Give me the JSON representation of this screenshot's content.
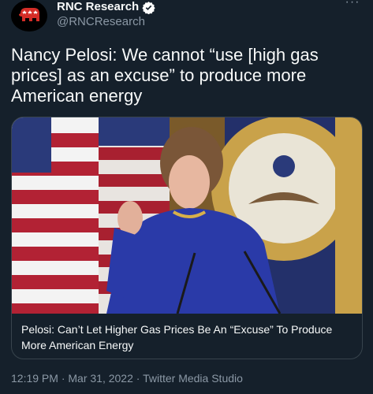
{
  "author": {
    "display_name": "RNC Research",
    "handle": "@RNCResearch"
  },
  "tweet": {
    "text": "Nancy Pelosi: We cannot “use [high gas prices] as an excuse” to produce more American energy"
  },
  "card": {
    "title": "Pelosi: Can’t Let Higher Gas Prices Be An “Excuse” To Produce More American Energy"
  },
  "meta": {
    "timestamp": "12:19 PM · Mar 31, 2022",
    "separator": " · ",
    "source": "Twitter Media Studio"
  },
  "colors": {
    "background": "#15202b",
    "secondary_text": "#8b98a5",
    "verified_badge": "#ffffff",
    "logo_red": "#d52d27"
  }
}
